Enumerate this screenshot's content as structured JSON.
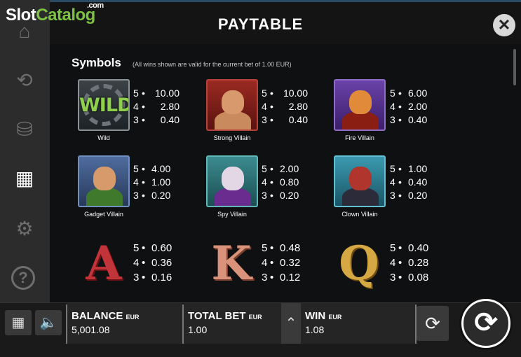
{
  "header": {
    "title": "PAYTABLE",
    "close_icon": "close-icon"
  },
  "watermark": {
    "slot": "Slot",
    "catalog": "Catalog",
    "com": ".com"
  },
  "sidebar": {
    "items": [
      {
        "name": "home-icon",
        "glyph": "⌂"
      },
      {
        "name": "replay-icon",
        "glyph": "⟲"
      },
      {
        "name": "coins-icon",
        "glyph": "⛁"
      },
      {
        "name": "grid-icon",
        "glyph": "▦",
        "active": true
      },
      {
        "name": "gear-icon",
        "glyph": "⚙"
      },
      {
        "name": "help-icon",
        "glyph": "?"
      }
    ]
  },
  "section": {
    "title": "Symbols",
    "note": "(All wins shown are valid for the current bet of 1.00 EUR)"
  },
  "symbols": [
    {
      "label": "Wild",
      "pays": [
        {
          "count": "5",
          "value": "10.00"
        },
        {
          "count": "4",
          "value": "2.80"
        },
        {
          "count": "3",
          "value": "0.40"
        }
      ]
    },
    {
      "label": "Strong Villain",
      "pays": [
        {
          "count": "5",
          "value": "10.00"
        },
        {
          "count": "4",
          "value": "2.80"
        },
        {
          "count": "3",
          "value": "0.40"
        }
      ]
    },
    {
      "label": "Fire Villain",
      "pays": [
        {
          "count": "5",
          "value": "6.00"
        },
        {
          "count": "4",
          "value": "2.00"
        },
        {
          "count": "3",
          "value": "0.40"
        }
      ]
    },
    {
      "label": "Gadget Villain",
      "pays": [
        {
          "count": "5",
          "value": "4.00"
        },
        {
          "count": "4",
          "value": "1.00"
        },
        {
          "count": "3",
          "value": "0.20"
        }
      ]
    },
    {
      "label": "Spy Villain",
      "pays": [
        {
          "count": "5",
          "value": "2.00"
        },
        {
          "count": "4",
          "value": "0.80"
        },
        {
          "count": "3",
          "value": "0.20"
        }
      ]
    },
    {
      "label": "Clown Villain",
      "pays": [
        {
          "count": "5",
          "value": "1.00"
        },
        {
          "count": "4",
          "value": "0.40"
        },
        {
          "count": "3",
          "value": "0.20"
        }
      ]
    },
    {
      "letter": "A",
      "pays": [
        {
          "count": "5",
          "value": "0.60"
        },
        {
          "count": "4",
          "value": "0.36"
        },
        {
          "count": "3",
          "value": "0.16"
        }
      ]
    },
    {
      "letter": "K",
      "pays": [
        {
          "count": "5",
          "value": "0.48"
        },
        {
          "count": "4",
          "value": "0.32"
        },
        {
          "count": "3",
          "value": "0.12"
        }
      ]
    },
    {
      "letter": "Q",
      "pays": [
        {
          "count": "5",
          "value": "0.40"
        },
        {
          "count": "4",
          "value": "0.28"
        },
        {
          "count": "3",
          "value": "0.08"
        }
      ]
    }
  ],
  "wild_text": "WILD",
  "bottom": {
    "balance": {
      "label": "BALANCE",
      "unit": "EUR",
      "value": "5,001.08"
    },
    "total_bet": {
      "label": "TOTAL BET",
      "unit": "EUR",
      "value": "1.00"
    },
    "win": {
      "label": "WIN",
      "unit": "EUR",
      "value": "1.08"
    },
    "menu_icon": "grid-menu-icon",
    "sound_icon": "speaker-icon",
    "chevron_icon": "chevron-up-icon",
    "autoplay_icon": "autoplay-icon",
    "spin_icon": "spin-icon"
  },
  "colors": {
    "accent": "#7dc242",
    "panel": "#0f1012",
    "bar": "#1a1a1a"
  }
}
